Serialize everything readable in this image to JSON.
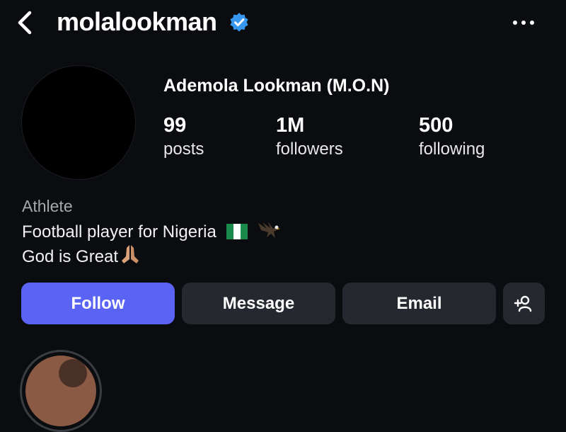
{
  "header": {
    "username": "molalookman",
    "icons": {
      "back": "chevron-left-icon",
      "verified": "verified-badge-icon",
      "more": "more-horizontal-icon"
    },
    "verified_color": "#3897f0"
  },
  "profile": {
    "display_name": "Ademola Lookman (M.O.N)",
    "stats": [
      {
        "value": "99",
        "label": "posts"
      },
      {
        "value": "1M",
        "label": "followers"
      },
      {
        "value": "500",
        "label": "following"
      }
    ],
    "category": "Athlete",
    "bio": {
      "line1": "Football player for Nigeria",
      "line1_emoji": [
        "nigeria-flag",
        "eagle"
      ],
      "line2": "God is Great",
      "line2_emoji": [
        "praying-hands"
      ]
    }
  },
  "actions": {
    "follow": "Follow",
    "message": "Message",
    "email": "Email",
    "add_user_icon": "add-person-icon",
    "follow_color": "#5b63f5"
  }
}
